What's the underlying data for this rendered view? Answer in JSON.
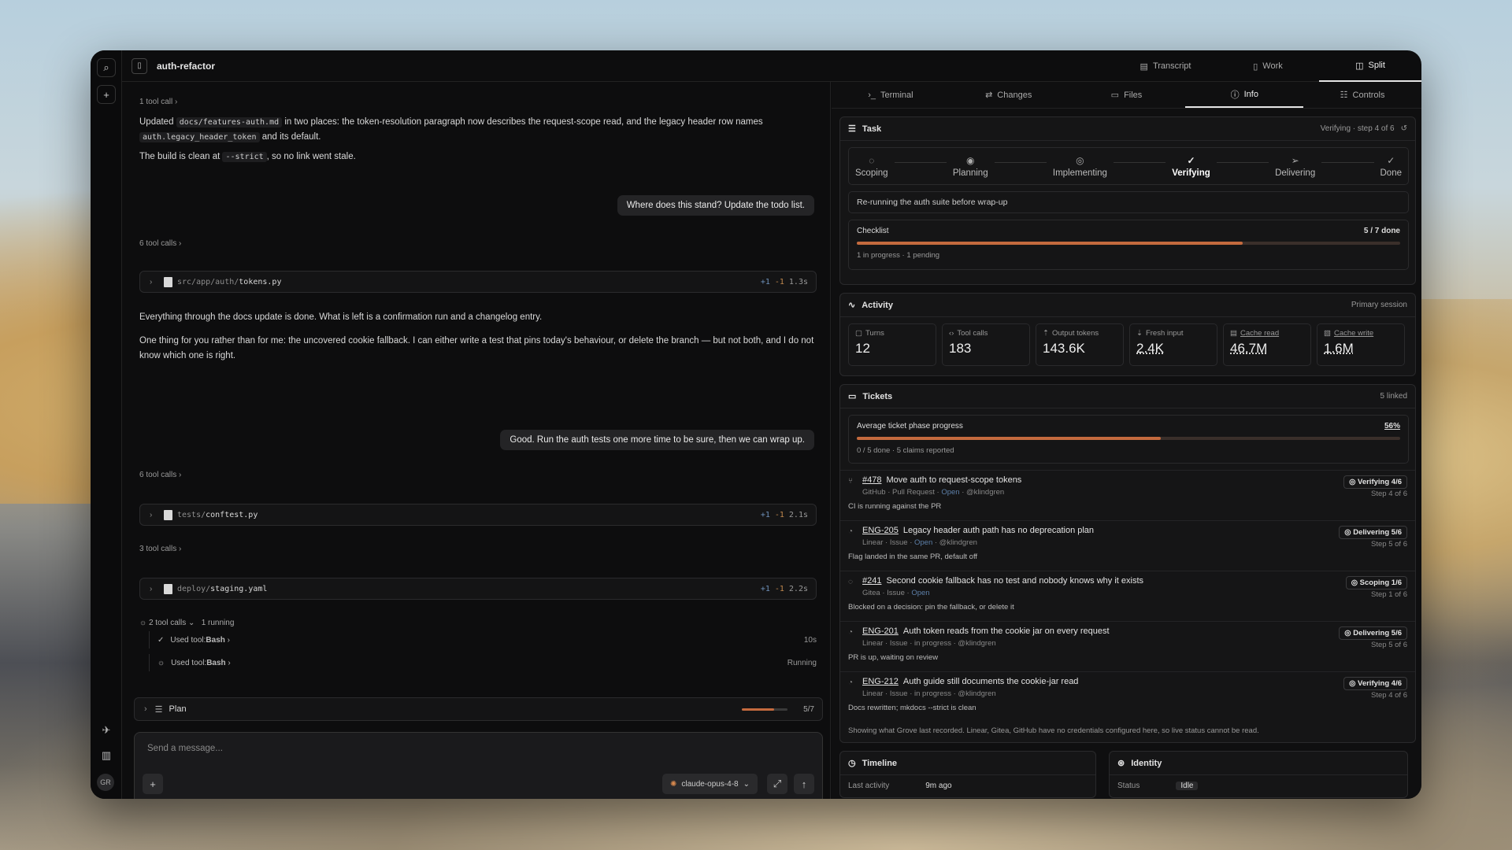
{
  "app": {
    "project_title": "auth-refactor"
  },
  "view_tabs": [
    "Transcript",
    "Work",
    "Split"
  ],
  "transcript": {
    "tc1": "1 tool call",
    "msg1_a": "Updated ",
    "msg1_code1": "docs/features-auth.md",
    "msg1_b": " in two places: the token-resolution paragraph now describes the request-scope read, and the legacy header row names ",
    "msg1_code2": "auth.legacy_header_token",
    "msg1_c": " and its default.",
    "msg2_a": "The build is clean at ",
    "msg2_code": "--strict",
    "msg2_b": ", so no link went stale.",
    "bubble1": "Where does this stand? Update the todo list.",
    "tc2": "6 tool calls",
    "file1_dir": "src/app/auth/",
    "file1_name": "tokens.py",
    "file1_add": "+1",
    "file1_del": "-1",
    "file1_time": "1.3s",
    "msg3": "Everything through the docs update is done. What is left is a confirmation run and a changelog entry.",
    "msg4": "One thing for you rather than for me: the uncovered cookie fallback. I can either write a test that pins today's behaviour, or delete the branch — but not both, and I do not know which one is right.",
    "bubble2": "Good. Run the auth tests one more time to be sure, then we can wrap up.",
    "tc3": "6 tool calls",
    "file2_dir": "tests/",
    "file2_name": "conftest.py",
    "file2_add": "+1",
    "file2_del": "-1",
    "file2_time": "2.1s",
    "tc4": "3 tool calls",
    "file3_dir": "deploy/",
    "file3_name": "staging.yaml",
    "file3_add": "+1",
    "file3_del": "-1",
    "file3_time": "2.2s",
    "tc5": "2 tool calls",
    "tc5_running": "1 running",
    "tool1_label": "Used tool: ",
    "tool1_name": "Bash",
    "tool1_time": "10s",
    "tool2_label": "Used tool: ",
    "tool2_name": "Bash",
    "tool2_status": "Running"
  },
  "plan": {
    "label": "Plan",
    "count": "5/7",
    "progress": 0.71
  },
  "composer": {
    "placeholder": "Send a message...",
    "model": "claude-opus-4-8"
  },
  "right_tabs": [
    "Terminal",
    "Changes",
    "Files",
    "Info",
    "Controls"
  ],
  "task": {
    "title": "Task",
    "status": "Verifying · step 4 of 6",
    "steps": [
      "Scoping",
      "Planning",
      "Implementing",
      "Verifying",
      "Delivering",
      "Done"
    ],
    "note": "Re-running the auth suite before wrap-up",
    "checklist_label": "Checklist",
    "checklist_count": "5 / 7 done",
    "checklist_progress": 0.71,
    "checklist_sub": "1 in progress · 1 pending"
  },
  "activity": {
    "title": "Activity",
    "session": "Primary session",
    "stats": [
      {
        "label": "Turns",
        "value": "12"
      },
      {
        "label": "Tool calls",
        "value": "183"
      },
      {
        "label": "Output tokens",
        "value": "143.6K"
      },
      {
        "label": "Fresh input",
        "value": "2.4K"
      },
      {
        "label": "Cache read",
        "value": "46.7M"
      },
      {
        "label": "Cache write",
        "value": "1.6M"
      }
    ]
  },
  "tickets": {
    "title": "Tickets",
    "linked": "5 linked",
    "avg_label": "Average ticket phase progress",
    "avg_pct": "56%",
    "avg_progress": 0.56,
    "avg_sub": "0 / 5 done · 5 claims reported",
    "items": [
      {
        "id": "#478",
        "title": "Move auth to request-scope tokens",
        "src": "GitHub · Pull Request · ",
        "state": "Open",
        "who": " · @klindgren",
        "note": "CI is running against the PR",
        "badge": "Verifying 4/6",
        "step": "Step 4 of 6"
      },
      {
        "id": "ENG-205",
        "title": "Legacy header auth path has no deprecation plan",
        "src": "Linear · Issue · ",
        "state": "Open",
        "who": " · @klindgren",
        "note": "Flag landed in the same PR, default off",
        "badge": "Delivering 5/6",
        "step": "Step 5 of 6"
      },
      {
        "id": "#241",
        "title": "Second cookie fallback has no test and nobody knows why it exists",
        "src": "Gitea · Issue · ",
        "state": "Open",
        "who": "",
        "note": "Blocked on a decision: pin the fallback, or delete it",
        "badge": "Scoping 1/6",
        "step": "Step 1 of 6"
      },
      {
        "id": "ENG-201",
        "title": "Auth token reads from the cookie jar on every request",
        "src": "Linear · Issue · in progress · @klindgren",
        "state": "",
        "who": "",
        "note": "PR is up, waiting on review",
        "badge": "Delivering 5/6",
        "step": "Step 5 of 6"
      },
      {
        "id": "ENG-212",
        "title": "Auth guide still documents the cookie-jar read",
        "src": "Linear · Issue · in progress · @klindgren",
        "state": "",
        "who": "",
        "note": "Docs rewritten; mkdocs --strict is clean",
        "badge": "Verifying 4/6",
        "step": "Step 4 of 6"
      }
    ],
    "footer": "Showing what Grove last recorded. Linear, Gitea, GitHub have no credentials configured here, so live status cannot be read."
  },
  "timeline": {
    "title": "Timeline",
    "row_label": "Last activity",
    "row_value": "9m ago"
  },
  "identity": {
    "title": "Identity",
    "row_label": "Status",
    "row_value": "Idle"
  },
  "avatar": "GR"
}
